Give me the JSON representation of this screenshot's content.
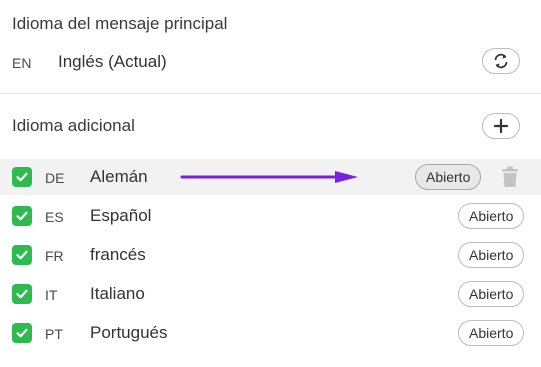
{
  "primary": {
    "title": "Idioma del mensaje principal",
    "code": "EN",
    "name": "Inglés (Actual)",
    "swap_icon": "refresh-icon"
  },
  "additional": {
    "title": "Idioma adicional",
    "add_icon": "plus-icon"
  },
  "languages": [
    {
      "code": "DE",
      "name": "Alemán",
      "checked": true,
      "button": "Abierto",
      "highlighted": true
    },
    {
      "code": "ES",
      "name": "Español",
      "checked": true,
      "button": "Abierto",
      "highlighted": false
    },
    {
      "code": "FR",
      "name": "francés",
      "checked": true,
      "button": "Abierto",
      "highlighted": false
    },
    {
      "code": "IT",
      "name": "Italiano",
      "checked": true,
      "button": "Abierto",
      "highlighted": false
    },
    {
      "code": "PT",
      "name": "Portugués",
      "checked": true,
      "button": "Abierto",
      "highlighted": false
    }
  ],
  "colors": {
    "checkbox": "#2dba4e",
    "arrow": "#7b1fe0",
    "highlight_row": "#f2f2f2"
  }
}
